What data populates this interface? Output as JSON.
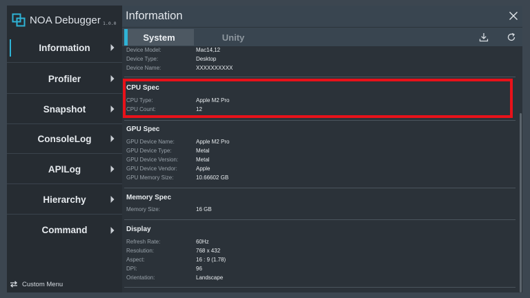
{
  "app": {
    "title": "NOA Debugger",
    "version": "1.0.0"
  },
  "sidebar": {
    "items": [
      {
        "label": "Information",
        "active": true
      },
      {
        "label": "Profiler",
        "active": false
      },
      {
        "label": "Snapshot",
        "active": false
      },
      {
        "label": "ConsoleLog",
        "active": false
      },
      {
        "label": "APILog",
        "active": false
      },
      {
        "label": "Hierarchy",
        "active": false
      },
      {
        "label": "Command",
        "active": false
      }
    ],
    "custom_menu_label": "Custom Menu"
  },
  "header": {
    "title": "Information"
  },
  "tabs": [
    {
      "label": "System",
      "active": true
    },
    {
      "label": "Unity",
      "active": false
    }
  ],
  "device": {
    "rows": [
      {
        "key": "Device Model:",
        "value": "Mac14,12"
      },
      {
        "key": "Device Type:",
        "value": "Desktop"
      },
      {
        "key": "Device Name:",
        "value": "XXXXXXXXXX"
      }
    ]
  },
  "cpu": {
    "title": "CPU Spec",
    "rows": [
      {
        "key": "CPU Type:",
        "value": "Apple M2 Pro"
      },
      {
        "key": "CPU Count:",
        "value": "12"
      }
    ]
  },
  "gpu": {
    "title": "GPU Spec",
    "rows": [
      {
        "key": "GPU Device Name:",
        "value": "Apple M2 Pro"
      },
      {
        "key": "GPU Device Type:",
        "value": "Metal"
      },
      {
        "key": "GPU Device Version:",
        "value": "Metal"
      },
      {
        "key": "GPU Device Vendor:",
        "value": "Apple"
      },
      {
        "key": "GPU Memory Size:",
        "value": "10.66602 GB"
      }
    ]
  },
  "memory": {
    "title": "Memory Spec",
    "rows": [
      {
        "key": "Memory Size:",
        "value": "16 GB"
      }
    ]
  },
  "display": {
    "title": "Display",
    "rows": [
      {
        "key": "Refresh Rate:",
        "value": "60Hz"
      },
      {
        "key": "Resolution:",
        "value": "768 x 432"
      },
      {
        "key": "Aspect:",
        "value": "16 : 9 (1.78)"
      },
      {
        "key": "DPI:",
        "value": "96"
      },
      {
        "key": "Orientation:",
        "value": "Landscape"
      }
    ]
  },
  "icons": {
    "logo": "noa-logo-icon",
    "chevron": "chevron-right-icon",
    "close": "close-icon",
    "download": "download-icon",
    "refresh": "refresh-icon",
    "custom_menu": "swap-arrows-icon"
  },
  "colors": {
    "accent": "#2fb3d6",
    "highlight": "#e8121a"
  }
}
